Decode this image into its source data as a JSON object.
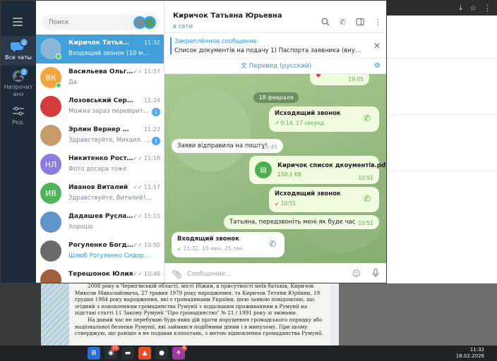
{
  "window": {
    "controls": [
      "—",
      "☐",
      "✕"
    ]
  },
  "rail": {
    "items": [
      {
        "label": "Все чаты",
        "badge": "2"
      },
      {
        "label": "Непрочит ано",
        "badge": "2"
      },
      {
        "label": "Ред."
      }
    ]
  },
  "search": {
    "placeholder": "Поиск"
  },
  "chats": [
    {
      "name": "Киричок Татьяна Юрь...",
      "time": "11:32",
      "last": "Входящий звонок (10 мин. 25 сек.)",
      "avatar_color": "#8bb6d6",
      "active": true,
      "online": true
    },
    {
      "name": "Васильева Ольга К...",
      "time": "11:57",
      "last": "Да",
      "initials": "ВК",
      "avatar_color": "#f4a340",
      "checked": true,
      "online": true
    },
    {
      "name": "Лозовський Сергей...",
      "time": "11:24",
      "last": "Можна зараз перевірити ...",
      "avatar_color": "#d43b3b",
      "badge": "1"
    },
    {
      "name": "Эрлин Вернер Сергеев...",
      "time": "11:23",
      "last": "Здравствуйте, Михаил. Хо...",
      "avatar_color": "#c89b6a",
      "badge": "1"
    },
    {
      "name": "Никитенко Ростисл...",
      "time": "11:18",
      "last": "Фото досара тоже",
      "initials": "НЛ",
      "avatar_color": "#8c7be0",
      "checked": true
    },
    {
      "name": "Иванов Виталий",
      "time": "11:17",
      "last": "Здравствуйте, Виталий! Вы с...",
      "initials": "ИВ",
      "avatar_color": "#4fb45a",
      "checked": true
    },
    {
      "name": "Дадашев Руслан Гюнд...",
      "time": "11:15",
      "last": "Хорошо",
      "avatar_color": "#5f95c9",
      "checked": true
    },
    {
      "name": "Рогуленко Богдан А...",
      "time": "10:50",
      "last": "Шлюб Рогуленко Сидорчук 1....",
      "avatar_color": "#6a6a6a",
      "checked": true,
      "accent": true
    },
    {
      "name": "Терешонок Юлия",
      "time": "10:46",
      "last": "",
      "avatar_color": "#a0603a",
      "checked": true
    }
  ],
  "chat": {
    "title": "Киричок Татьяна Юрьевна",
    "status": "в сети",
    "pinned_title": "Закреплённое сообщение",
    "pinned_text": "Список документів на подачу  1) Паспорта заявника (внутрішній ...",
    "translate_label": "Перевод (русский)",
    "date_chip": "18 февраля",
    "messages": {
      "m0_time": "19:05",
      "m1_title": "Исходящий звонок",
      "m1_sub": "9:14, 17 секунд",
      "m2_text": "Заяви відправила на пошту!",
      "m2_time": "10:45",
      "m3_file": "Киричок список дкоументів.pdf",
      "m3_size": "150.1 KB",
      "m3_time": "10:51",
      "m4_title": "Исходящий звонок",
      "m4_sub": "10:51",
      "m5_text": "Татьяна, передзвоніть мені як буде час",
      "m5_time": "10:51",
      "m6_title": "Входящий звонок",
      "m6_sub": "11:32, 10 мин. 25 сек."
    },
    "composer_placeholder": "Сообщение..."
  },
  "document": {
    "p1": "2008 року в Чернігівській області, місті Ніжин, в присутності моїх батьків, Киричок Миколи Миколайовича, 27 травня 1979 року народження, та Киричок Тетяни Юріївни, 19 грудня 1984 року народження, які є громадянами України, цією заявою повідомляю, що згідний з поновленням громадянства Румунії з подальшим проживанням в Румунії на підставі статті 11 Закону Румунії \"Про громадянство\" № 21 / 1991 року зі змінами.",
    "p2": "На даний час не перебуваю будь-яких дій проти порушення громадського порядку або національної безпеки Румунії, які займався подібними діями і в минулому. При цьому стверджую, що раніше я не подавав клопотань, з метою відновлення громадянства Румунії."
  },
  "taskbar": {
    "time": "11:32",
    "date": "18.02.2026",
    "badges": [
      "14",
      "6"
    ]
  }
}
